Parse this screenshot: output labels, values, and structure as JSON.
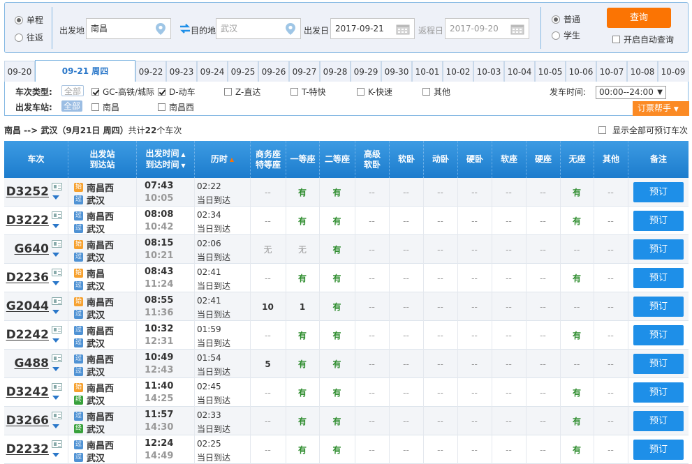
{
  "search": {
    "trip_types": [
      {
        "label": "单程",
        "checked": true
      },
      {
        "label": "往返",
        "checked": false
      }
    ],
    "from_label": "出发地",
    "from_value": "南昌",
    "to_label": "目的地",
    "to_placeholder": "武汉",
    "depart_label": "出发日",
    "depart_value": "2017-09-21",
    "return_label": "返程日",
    "return_placeholder": "2017-09-20",
    "passenger_types": [
      {
        "label": "普通",
        "checked": true
      },
      {
        "label": "学生",
        "checked": false
      }
    ],
    "query_label": "查询",
    "auto_query_label": "开启自动查询"
  },
  "date_tabs": [
    "09-20",
    "09-21 周四",
    "09-22",
    "09-23",
    "09-24",
    "09-25",
    "09-26",
    "09-27",
    "09-28",
    "09-29",
    "09-30",
    "10-01",
    "10-02",
    "10-03",
    "10-04",
    "10-05",
    "10-06",
    "10-07",
    "10-08",
    "10-09"
  ],
  "active_date_index": 1,
  "filters": {
    "type_label": "车次类型:",
    "all_label": "全部",
    "types": [
      {
        "label": "GC-高铁/城际",
        "checked": true
      },
      {
        "label": "D-动车",
        "checked": true
      },
      {
        "label": "Z-直达",
        "checked": false
      },
      {
        "label": "T-特快",
        "checked": false
      },
      {
        "label": "K-快速",
        "checked": false
      },
      {
        "label": "其他",
        "checked": false
      }
    ],
    "station_label": "出发车站:",
    "station_all_label": "全部",
    "stations": [
      {
        "label": "南昌",
        "checked": false
      },
      {
        "label": "南昌西",
        "checked": false
      }
    ],
    "time_label": "发车时间:",
    "time_value": "00:00--24:00",
    "helper_label": "订票帮手"
  },
  "summary": {
    "route": "南昌 --> 武汉",
    "date": "（9月21日  周四）",
    "count_prefix": "共计",
    "count": "22",
    "count_suffix": "个车次"
  },
  "show_all_label": "显示全部可预订车次",
  "headers": {
    "train": "车次",
    "station_top": "出发站",
    "station_bottom": "到达站",
    "time_top": "出发时间",
    "time_bottom": "到达时间",
    "duration": "历时",
    "business_top": "商务座",
    "business_bottom": "特等座",
    "first": "一等座",
    "second": "二等座",
    "adv_soft_top": "高级",
    "adv_soft_bottom": "软卧",
    "soft_sleeper": "软卧",
    "dong_sleeper": "动卧",
    "hard_sleeper": "硬卧",
    "soft_seat": "软座",
    "hard_seat": "硬座",
    "no_seat": "无座",
    "other": "其他",
    "remark": "备注"
  },
  "trains": [
    {
      "no": "D3252",
      "from": "南昌西",
      "from_badge": "始",
      "to": "武汉",
      "to_badge": "过",
      "dep": "07:43",
      "arr": "10:05",
      "dur": "02:22",
      "note": "当日到达",
      "seats": [
        "--",
        "有",
        "有",
        "--",
        "--",
        "--",
        "--",
        "--",
        "--",
        "有",
        "--"
      ],
      "book": "预订"
    },
    {
      "no": "D3222",
      "from": "南昌西",
      "from_badge": "过",
      "to": "武汉",
      "to_badge": "过",
      "dep": "08:08",
      "arr": "10:42",
      "dur": "02:34",
      "note": "当日到达",
      "seats": [
        "--",
        "有",
        "有",
        "--",
        "--",
        "--",
        "--",
        "--",
        "--",
        "有",
        "--"
      ],
      "book": "预订"
    },
    {
      "no": "G640",
      "from": "南昌西",
      "from_badge": "始",
      "to": "武汉",
      "to_badge": "过",
      "dep": "08:15",
      "arr": "10:21",
      "dur": "02:06",
      "note": "当日到达",
      "seats": [
        "无",
        "无",
        "有",
        "--",
        "--",
        "--",
        "--",
        "--",
        "--",
        "--",
        "--"
      ],
      "book": "预订"
    },
    {
      "no": "D2236",
      "from": "南昌",
      "from_badge": "始",
      "to": "武汉",
      "to_badge": "过",
      "dep": "08:43",
      "arr": "11:24",
      "dur": "02:41",
      "note": "当日到达",
      "seats": [
        "--",
        "有",
        "有",
        "--",
        "--",
        "--",
        "--",
        "--",
        "--",
        "有",
        "--"
      ],
      "book": "预订"
    },
    {
      "no": "G2044",
      "from": "南昌西",
      "from_badge": "始",
      "to": "武汉",
      "to_badge": "过",
      "dep": "08:55",
      "arr": "11:36",
      "dur": "02:41",
      "note": "当日到达",
      "seats": [
        "10",
        "1",
        "有",
        "--",
        "--",
        "--",
        "--",
        "--",
        "--",
        "--",
        "--"
      ],
      "book": "预订"
    },
    {
      "no": "D2242",
      "from": "南昌西",
      "from_badge": "过",
      "to": "武汉",
      "to_badge": "过",
      "dep": "10:32",
      "arr": "12:31",
      "dur": "01:59",
      "note": "当日到达",
      "seats": [
        "--",
        "有",
        "有",
        "--",
        "--",
        "--",
        "--",
        "--",
        "--",
        "有",
        "--"
      ],
      "book": "预订"
    },
    {
      "no": "G488",
      "from": "南昌西",
      "from_badge": "过",
      "to": "武汉",
      "to_badge": "过",
      "dep": "10:49",
      "arr": "12:43",
      "dur": "01:54",
      "note": "当日到达",
      "seats": [
        "5",
        "有",
        "有",
        "--",
        "--",
        "--",
        "--",
        "--",
        "--",
        "--",
        "--"
      ],
      "book": "预订"
    },
    {
      "no": "D3242",
      "from": "南昌西",
      "from_badge": "始",
      "to": "武汉",
      "to_badge": "终",
      "dep": "11:40",
      "arr": "14:25",
      "dur": "02:45",
      "note": "当日到达",
      "seats": [
        "--",
        "有",
        "有",
        "--",
        "--",
        "--",
        "--",
        "--",
        "--",
        "有",
        "--"
      ],
      "book": "预订"
    },
    {
      "no": "D3266",
      "from": "南昌西",
      "from_badge": "过",
      "to": "武汉",
      "to_badge": "终",
      "dep": "11:57",
      "arr": "14:30",
      "dur": "02:33",
      "note": "当日到达",
      "seats": [
        "--",
        "有",
        "有",
        "--",
        "--",
        "--",
        "--",
        "--",
        "--",
        "有",
        "--"
      ],
      "book": "预订"
    },
    {
      "no": "D2232",
      "from": "南昌西",
      "from_badge": "过",
      "to": "武汉",
      "to_badge": "过",
      "dep": "12:24",
      "arr": "14:49",
      "dur": "02:25",
      "note": "当日到达",
      "seats": [
        "--",
        "有",
        "有",
        "--",
        "--",
        "--",
        "--",
        "--",
        "--",
        "有",
        "--"
      ],
      "book": "预订"
    }
  ]
}
